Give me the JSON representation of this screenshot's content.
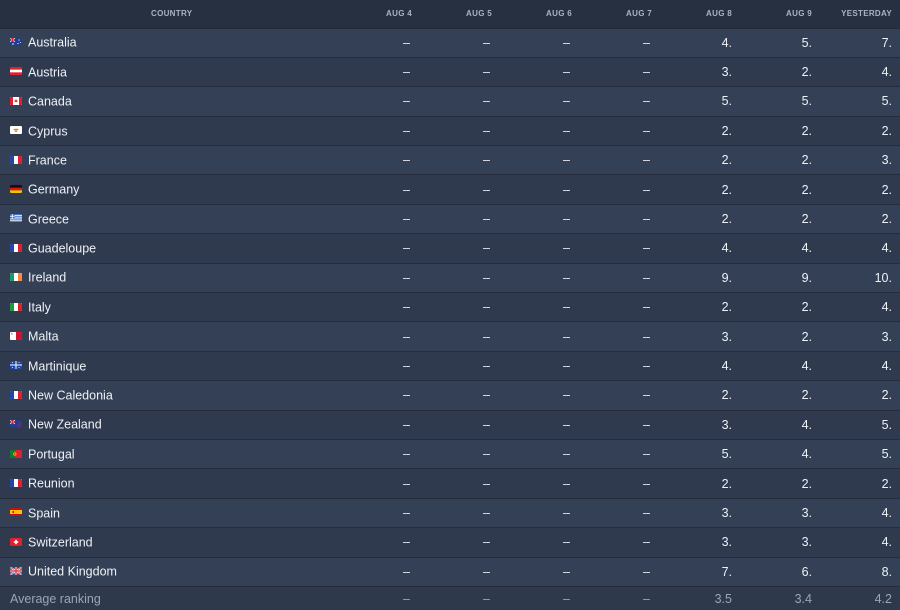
{
  "table": {
    "headers": {
      "country": "COUNTRY",
      "days": [
        "AUG 4",
        "AUG 5",
        "AUG 6",
        "AUG 7",
        "AUG 8",
        "AUG 9",
        "YESTERDAY"
      ]
    },
    "rows": [
      {
        "country": "Australia",
        "flag": "australia-flag-icon",
        "values": [
          "–",
          "–",
          "–",
          "–",
          "4.",
          "5.",
          "7."
        ]
      },
      {
        "country": "Austria",
        "flag": "austria-flag-icon",
        "values": [
          "–",
          "–",
          "–",
          "–",
          "3.",
          "2.",
          "4."
        ]
      },
      {
        "country": "Canada",
        "flag": "canada-flag-icon",
        "values": [
          "–",
          "–",
          "–",
          "–",
          "5.",
          "5.",
          "5."
        ]
      },
      {
        "country": "Cyprus",
        "flag": "cyprus-flag-icon",
        "values": [
          "–",
          "–",
          "–",
          "–",
          "2.",
          "2.",
          "2."
        ]
      },
      {
        "country": "France",
        "flag": "france-flag-icon",
        "values": [
          "–",
          "–",
          "–",
          "–",
          "2.",
          "2.",
          "3."
        ]
      },
      {
        "country": "Germany",
        "flag": "germany-flag-icon",
        "values": [
          "–",
          "–",
          "–",
          "–",
          "2.",
          "2.",
          "2."
        ]
      },
      {
        "country": "Greece",
        "flag": "greece-flag-icon",
        "values": [
          "–",
          "–",
          "–",
          "–",
          "2.",
          "2.",
          "2."
        ]
      },
      {
        "country": "Guadeloupe",
        "flag": "guadeloupe-flag-icon",
        "values": [
          "–",
          "–",
          "–",
          "–",
          "4.",
          "4.",
          "4."
        ]
      },
      {
        "country": "Ireland",
        "flag": "ireland-flag-icon",
        "values": [
          "–",
          "–",
          "–",
          "–",
          "9.",
          "9.",
          "10."
        ]
      },
      {
        "country": "Italy",
        "flag": "italy-flag-icon",
        "values": [
          "–",
          "–",
          "–",
          "–",
          "2.",
          "2.",
          "4."
        ]
      },
      {
        "country": "Malta",
        "flag": "malta-flag-icon",
        "values": [
          "–",
          "–",
          "–",
          "–",
          "3.",
          "2.",
          "3."
        ]
      },
      {
        "country": "Martinique",
        "flag": "martinique-flag-icon",
        "values": [
          "–",
          "–",
          "–",
          "–",
          "4.",
          "4.",
          "4."
        ]
      },
      {
        "country": "New Caledonia",
        "flag": "new-caledonia-flag-icon",
        "values": [
          "–",
          "–",
          "–",
          "–",
          "2.",
          "2.",
          "2."
        ]
      },
      {
        "country": "New Zealand",
        "flag": "new-zealand-flag-icon",
        "values": [
          "–",
          "–",
          "–",
          "–",
          "3.",
          "4.",
          "5."
        ]
      },
      {
        "country": "Portugal",
        "flag": "portugal-flag-icon",
        "values": [
          "–",
          "–",
          "–",
          "–",
          "5.",
          "4.",
          "5."
        ]
      },
      {
        "country": "Reunion",
        "flag": "reunion-flag-icon",
        "values": [
          "–",
          "–",
          "–",
          "–",
          "2.",
          "2.",
          "2."
        ]
      },
      {
        "country": "Spain",
        "flag": "spain-flag-icon",
        "values": [
          "–",
          "–",
          "–",
          "–",
          "3.",
          "3.",
          "4."
        ]
      },
      {
        "country": "Switzerland",
        "flag": "switzerland-flag-icon",
        "values": [
          "–",
          "–",
          "–",
          "–",
          "3.",
          "3.",
          "4."
        ]
      },
      {
        "country": "United Kingdom",
        "flag": "united-kingdom-flag-icon",
        "values": [
          "–",
          "–",
          "–",
          "–",
          "7.",
          "6.",
          "8."
        ]
      }
    ],
    "average": {
      "label": "Average ranking",
      "values": [
        "–",
        "–",
        "–",
        "–",
        "3.5",
        "3.4",
        "4.2"
      ]
    }
  },
  "colors": {
    "background": "#2b3445",
    "row_odd": "#344055",
    "row_even": "#2f3a4e",
    "header_text": "#aab3c2"
  }
}
